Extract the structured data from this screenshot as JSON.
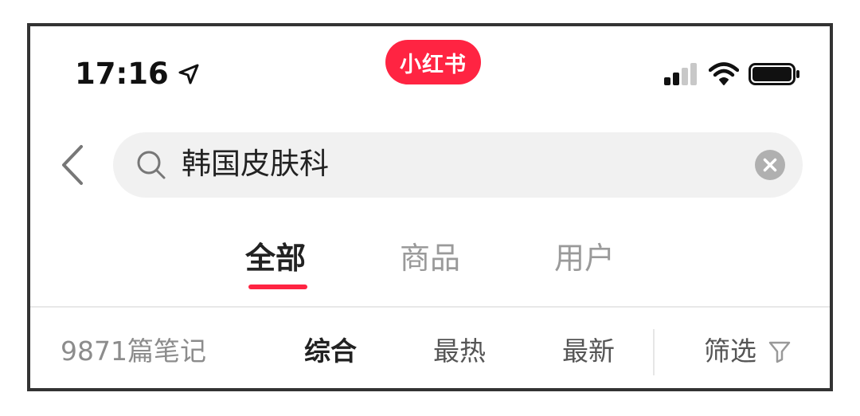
{
  "status_bar": {
    "time": "17:16",
    "brand": "小红书"
  },
  "search": {
    "query": "韩国皮肤科"
  },
  "tabs": [
    {
      "label": "全部",
      "active": true
    },
    {
      "label": "商品",
      "active": false
    },
    {
      "label": "用户",
      "active": false
    }
  ],
  "sort_bar": {
    "count": "9871篇笔记",
    "options": [
      {
        "label": "综合",
        "active": true
      },
      {
        "label": "最热",
        "active": false
      },
      {
        "label": "最新",
        "active": false
      }
    ],
    "filter_label": "筛选"
  },
  "colors": {
    "brand_red": "#ff2442",
    "active_text": "#222222",
    "inactive_text": "#9a9a9a"
  },
  "icons": [
    "location-arrow-icon",
    "signal-icon",
    "wifi-icon",
    "battery-icon",
    "back-chevron-icon",
    "search-icon",
    "clear-icon",
    "filter-funnel-icon"
  ]
}
